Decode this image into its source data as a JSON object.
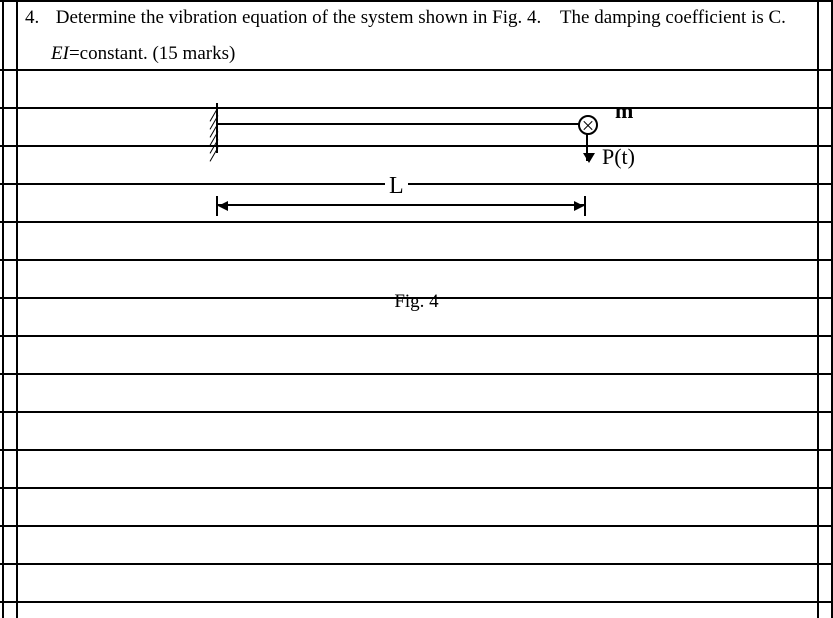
{
  "question": {
    "number": "4.",
    "line1_before": "Determine the vibration equation of the system shown in Fig. 4.",
    "line1_after": "The damping coefficient is C.",
    "line2_before_em": "",
    "line2_em": "EI",
    "line2_after_em": "=constant. (15 marks)"
  },
  "figure": {
    "mass_label": "m",
    "force_label": "P(t)",
    "length_label": "L",
    "caption": "Fig. 4"
  }
}
